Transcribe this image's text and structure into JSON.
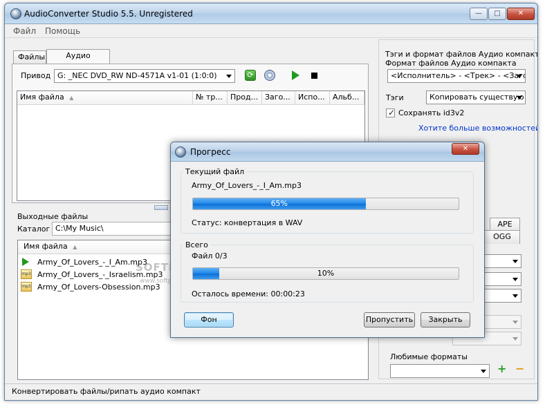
{
  "app": {
    "title": "AudioConverter Studio 5.5. Unregistered"
  },
  "menu": {
    "file": "Файл",
    "help": "Помощь"
  },
  "tabs": {
    "files": "Файлы",
    "audio_cd": "Аудио компакт"
  },
  "drive": {
    "label": "Привод",
    "value": "G: _NEC DVD_RW ND-4571A v1-01 (1:0:0)"
  },
  "cd_table": {
    "columns": [
      "Имя файла",
      "№ тр...",
      "Прод...",
      "Заго...",
      "Испо...",
      "Альб..."
    ]
  },
  "output": {
    "title": "Выходные файлы",
    "folder_label": "Каталог",
    "folder_value": "C:\\My Music\\",
    "column": "Имя файла"
  },
  "files": [
    {
      "name": "Army_Of_Lovers_-_I_Am.mp3",
      "icon": "play-icon"
    },
    {
      "name": "Army_Of_Lovers_-_Israelism.mp3",
      "icon": "mp3-icon"
    },
    {
      "name": "Army_Of_Lovers-Obsession.mp3",
      "icon": "mp3-icon"
    }
  ],
  "watermark": {
    "brand": "SOFTPORTAL",
    "url": "www.softportal.com"
  },
  "right_panel": {
    "tags_format_line1": "Тэги и формат файлов Аудио компакта",
    "tags_format_line2": "Формат файлов Аудио компакта",
    "pattern_value": "<Исполнитель> - <Трек> - <Заголо",
    "tags_label": "Тэги",
    "tags_value": "Копировать существую",
    "keep_id3": "Сохранять id3v2",
    "keep_id3_checked": true,
    "more_link": "Хотите больше возможностей?",
    "format_tabs": [
      "APE",
      "OGG"
    ],
    "favorites_label": "Любимые форматы",
    "add_symbol": "+",
    "remove_symbol": "−"
  },
  "status": "Конвертировать файлы/рипать аудио компакт",
  "dialog": {
    "title": "Прогресс",
    "current_group": "Текущий файл",
    "current_file": "Army_Of_Lovers_-_I_Am.mp3",
    "current_progress": 65,
    "current_progress_text": "65%",
    "status_text": "Статус: конвертация в WAV",
    "total_group": "Всего",
    "total_file": "Файл  0/3",
    "total_progress": 10,
    "total_progress_text": "10%",
    "time_left": "Осталось времени: 00:00:23",
    "btn_background": "Фон",
    "btn_skip": "Пропустить",
    "btn_close": "Закрыть"
  },
  "colors": {
    "accent": "#1e86e8",
    "link": "#0033cc",
    "title_bar": "#bcd3ea"
  }
}
